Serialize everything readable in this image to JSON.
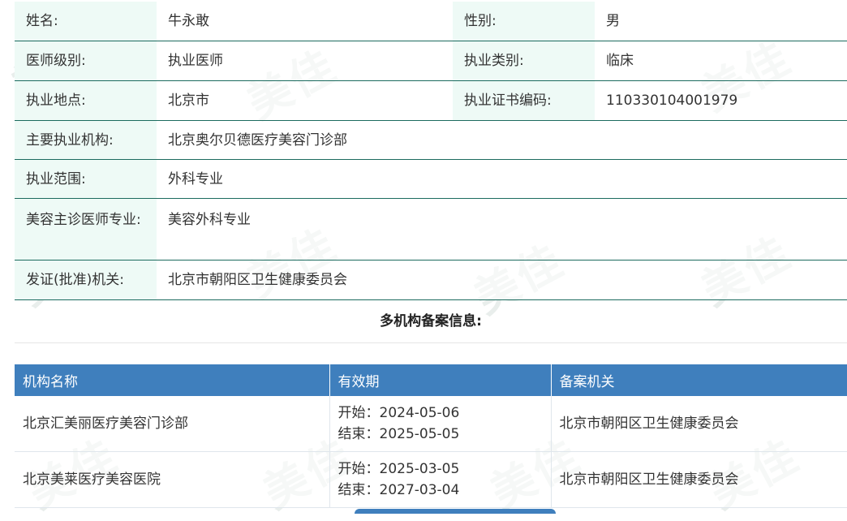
{
  "info_rows": [
    {
      "label1": "姓名:",
      "value1": "牛永敢",
      "label2": "性别:",
      "value2": "男"
    },
    {
      "label1": "医师级别:",
      "value1": "执业医师",
      "label2": "执业类别:",
      "value2": "临床"
    },
    {
      "label1": "执业地点:",
      "value1": "北京市",
      "label2": "执业证书编码:",
      "value2": "110330104001979"
    }
  ],
  "wide_rows": [
    {
      "label": "主要执业机构:",
      "value": "北京奥尔贝德医疗美容门诊部"
    },
    {
      "label": "执业范围:",
      "value": "外科专业"
    },
    {
      "label": "美容主诊医师专业:",
      "value": "美容外科专业"
    },
    {
      "label": "发证(批准)机关:",
      "value": "北京市朝阳区卫生健康委员会"
    }
  ],
  "section_title": "多机构备案信息:",
  "reg_table": {
    "headers": [
      "机构名称",
      "有效期",
      "备案机关"
    ],
    "rows": [
      {
        "name": "北京汇美丽医疗美容门诊部",
        "start": "开始：2024-05-06",
        "end": "结束：2025-05-05",
        "authority": "北京市朝阳区卫生健康委员会"
      },
      {
        "name": "北京美莱医疗美容医院",
        "start": "开始：2025-03-05",
        "end": "结束：2027-03-04",
        "authority": "北京市朝阳区卫生健康委员会"
      }
    ]
  },
  "colors": {
    "label_bg": "#eefaf6",
    "border": "#1c6b5f",
    "header_bg": "#3f7fbd"
  }
}
